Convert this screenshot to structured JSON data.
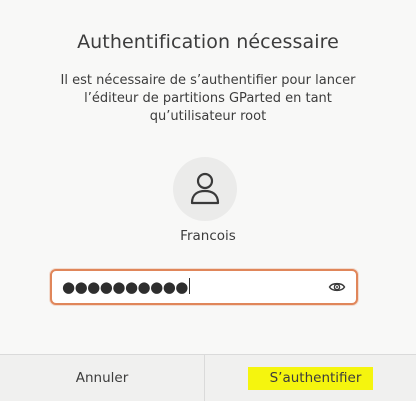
{
  "dialog": {
    "title": "Authentification nécessaire",
    "message": "Il est nécessaire de s’authentifier pour lancer\nl’éditeur de partitions GParted en tant\nqu’utilisateur root",
    "username": "Francois",
    "password_mask": "●●●●●●●●●●",
    "reveal_icon": "eye-icon",
    "avatar_icon": "user-icon"
  },
  "buttons": {
    "cancel_label": "Annuler",
    "authenticate_label": "S’authentifier",
    "authenticate_highlight": "#f5f50e"
  },
  "colors": {
    "focus_border": "#e0865a",
    "background": "#f8f8f7"
  }
}
